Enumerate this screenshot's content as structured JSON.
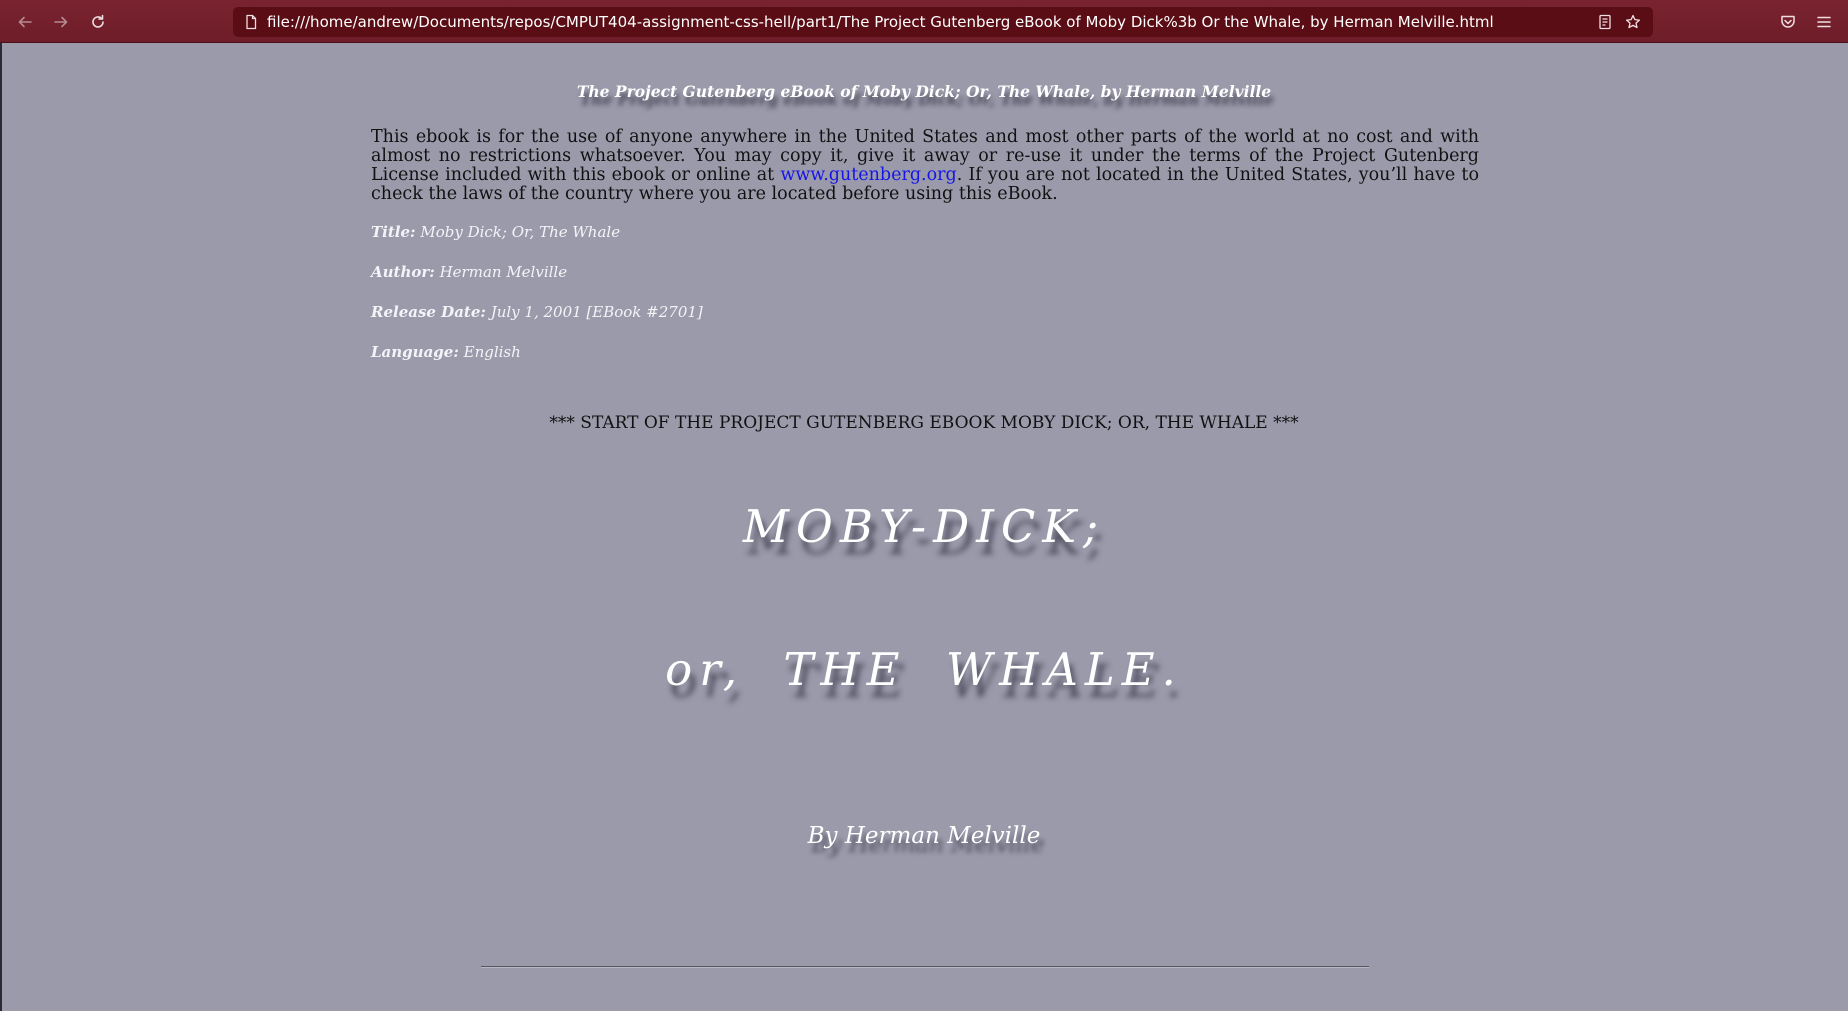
{
  "browser": {
    "url": "file:///home/andrew/Documents/repos/CMPUT404-assignment-css-hell/part1/The Project Gutenberg eBook of Moby Dick%3b Or the Whale, by Herman Melville.html",
    "icons": {
      "back": "arrow-left-icon",
      "forward": "arrow-right-icon",
      "reload": "reload-icon",
      "page": "page-icon",
      "reader": "reader-view-icon",
      "bookmark": "star-icon",
      "pocket": "pocket-icon",
      "menu": "hamburger-menu-icon"
    }
  },
  "document": {
    "heading": "The Project Gutenberg eBook of Moby Dick; Or, The Whale, by Herman Melville",
    "intro_before_link": "This ebook is for the use of anyone anywhere in the United States and most other parts of the world at no cost and with almost no restrictions whatsoever. You may copy it, give it away or re-use it under the terms of the Project Gutenberg License included with this ebook or online at ",
    "intro_link": "www.gutenberg.org",
    "intro_after_link": ". If you are not located in the United States, you’ll have to check the laws of the country where you are located before using this eBook.",
    "meta": {
      "title_key": "Title:",
      "title_value": " Moby Dick; Or, The Whale",
      "author_key": "Author:",
      "author_value": " Herman Melville",
      "release_key": "Release Date:",
      "release_value": " July 1, 2001 [EBook #2701]",
      "language_key": "Language:",
      "language_value": " English"
    },
    "start_marker": "*** START OF THE PROJECT GUTENBERG EBOOK MOBY DICK; OR, THE WHALE ***",
    "title_line_1": "MOBY-DICK;",
    "title_line_2": "or, THE WHALE.",
    "byline": "By Herman Melville"
  },
  "colors": {
    "toolbar": "#722030",
    "urlbar": "#5a0d14",
    "page_background": "#9b9aab",
    "link": "#1515e8"
  }
}
